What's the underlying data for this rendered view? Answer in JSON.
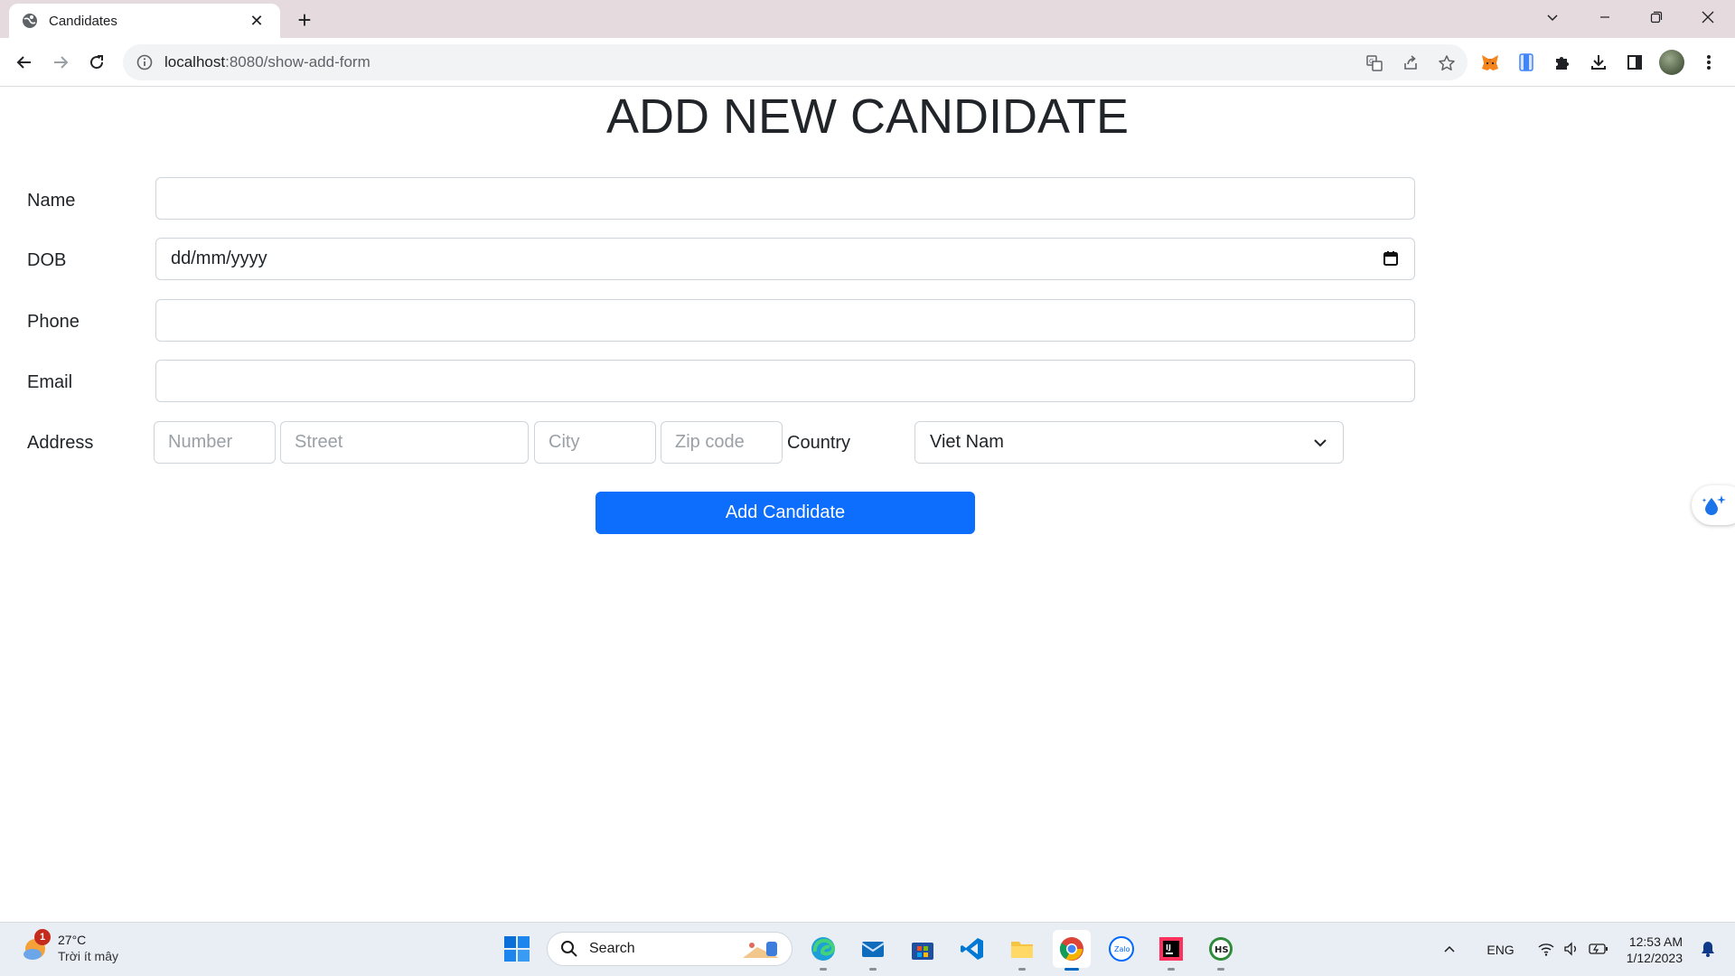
{
  "browser": {
    "tab_title": "Candidates",
    "url_host": "localhost",
    "url_rest": ":8080/show-add-form"
  },
  "page": {
    "title": "ADD NEW CANDIDATE",
    "fields": {
      "name_label": "Name",
      "dob_label": "DOB",
      "dob_placeholder": "dd/mm/yyyy",
      "phone_label": "Phone",
      "email_label": "Email",
      "address_label": "Address",
      "number_placeholder": "Number",
      "street_placeholder": "Street",
      "city_placeholder": "City",
      "zip_placeholder": "Zip code",
      "country_label": "Country",
      "country_value": "Viet Nam"
    },
    "submit_label": "Add Candidate"
  },
  "taskbar": {
    "weather_temp": "27°C",
    "weather_desc": "Trời ít mây",
    "weather_badge": "1",
    "search_label": "Search",
    "language": "ENG",
    "time": "12:53 AM",
    "date": "1/12/2023"
  },
  "colors": {
    "primary": "#0d6efd",
    "tabbar": "#e5dadd",
    "taskbar": "#e9eef5"
  }
}
